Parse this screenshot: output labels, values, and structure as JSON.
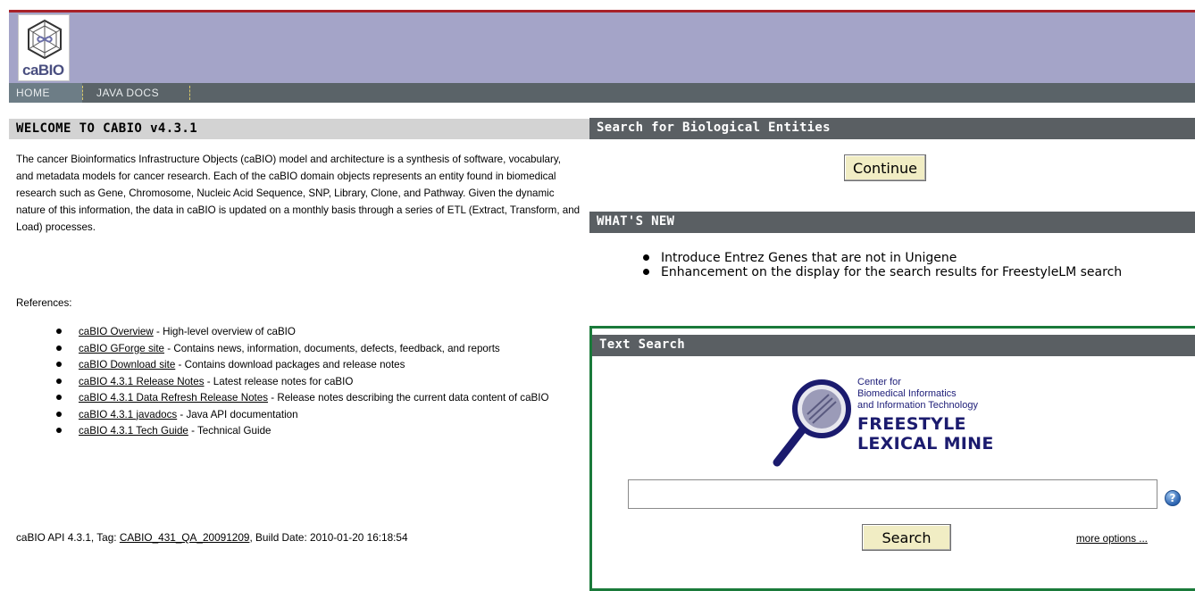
{
  "logo": {
    "text": "caBIO"
  },
  "nav": {
    "tabs": [
      "HOME",
      "JAVA DOCS"
    ],
    "active": "HOME"
  },
  "welcome": {
    "title": "WELCOME TO CABIO v4.3.1",
    "paragraph": "The cancer Bioinformatics Infrastructure Objects (caBIO) model and architecture is a synthesis of software, vocabulary, and metadata models for cancer research. Each of the caBIO domain objects represents an entity found in biomedical research such as Gene, Chromosome, Nucleic Acid Sequence, SNP, Library, Clone, and Pathway. Given the dynamic nature of this information, the data in caBIO is updated on a monthly basis through a series of ETL (Extract, Transform, and Load) processes.",
    "references_label": "References:",
    "references": [
      {
        "link": "caBIO Overview",
        "desc": " - High-level overview of caBIO"
      },
      {
        "link": "caBIO GForge site",
        "desc": " - Contains news, information, documents, defects, feedback, and reports"
      },
      {
        "link": "caBIO Download site",
        "desc": " - Contains download packages and release notes"
      },
      {
        "link": "caBIO 4.3.1 Release Notes",
        "desc": " - Latest release notes for caBIO"
      },
      {
        "link": "caBIO 4.3.1 Data Refresh Release Notes",
        "desc": " - Release notes describing the current data content of caBIO"
      },
      {
        "link": "caBIO 4.3.1 javadocs",
        "desc": " - Java API documentation"
      },
      {
        "link": "caBIO 4.3.1 Tech Guide",
        "desc": " - Technical Guide"
      }
    ],
    "api_prefix": "caBIO API 4.3.1, Tag: ",
    "api_tag": "CABIO_431_QA_20091209",
    "api_suffix": ", Build Date: 2010-01-20 16:18:54"
  },
  "search_entities": {
    "title": "Search for Biological Entities",
    "button": "Continue"
  },
  "whats_new": {
    "title": "WHAT'S NEW",
    "items": [
      "Introduce Entrez Genes that are not in Unigene",
      "Enhancement on the display for the search results for FreestyleLM search"
    ]
  },
  "text_search": {
    "title": "Text Search",
    "logo_small": [
      "Center for",
      "Biomedical Informatics",
      "and Information Technology"
    ],
    "logo_big": [
      "FREESTYLE",
      "LEXICAL MINE"
    ],
    "input_value": "",
    "button": "Search",
    "more_options": "more options ..."
  },
  "colors": {
    "banner": "#a4a4c8",
    "top_rule": "#a8222a",
    "navbar": "#5a6368",
    "section_header": "#5a5f63",
    "left_header": "#d3d3d3",
    "text_search_border": "#1a7a3a",
    "button_face": "#f1edc4"
  }
}
